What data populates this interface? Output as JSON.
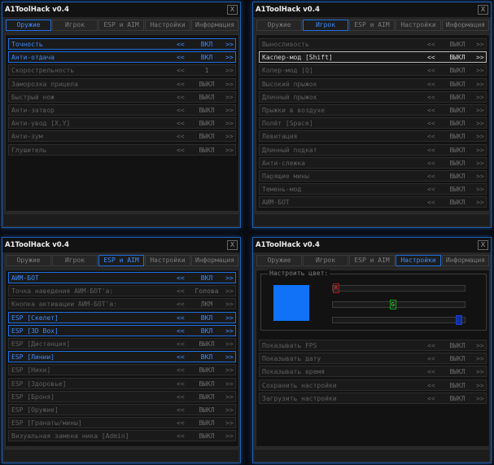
{
  "title": "A1ToolHack v0.4",
  "close": "X",
  "tabs": [
    "Оружие",
    "Игрок",
    "ESP и AIM",
    "Настройки",
    "Информация"
  ],
  "arrow_left": "<<",
  "arrow_right": ">>",
  "colors": {
    "accent": "#1f6fe0",
    "preview": "#0f72f7"
  },
  "weapons": {
    "rows": [
      {
        "label": "Точность",
        "value": "ВКЛ",
        "state": "on"
      },
      {
        "label": "Анти-отдача",
        "value": "ВКЛ",
        "state": "on"
      },
      {
        "label": "Скорострельность",
        "value": "1",
        "state": "off"
      },
      {
        "label": "Заморозка прицела",
        "value": "ВЫКЛ",
        "state": "off"
      },
      {
        "label": "Быстрый нож",
        "value": "ВЫКЛ",
        "state": "off"
      },
      {
        "label": "Анти-затвор",
        "value": "ВЫКЛ",
        "state": "off"
      },
      {
        "label": "Анти-увод [X,Y]",
        "value": "ВЫКЛ",
        "state": "off"
      },
      {
        "label": "Анти-зум",
        "value": "ВЫКЛ",
        "state": "off"
      },
      {
        "label": "Глушитель",
        "value": "ВЫКЛ",
        "state": "off"
      }
    ]
  },
  "player": {
    "rows": [
      {
        "label": "Выносливость",
        "value": "ВЫКЛ",
        "state": "off"
      },
      {
        "label": "Каспер-мод [Shift]",
        "value": "ВЫКЛ",
        "state": "sel"
      },
      {
        "label": "Копер-мод [Q]",
        "value": "ВЫКЛ",
        "state": "off"
      },
      {
        "label": "Высокий прыжок",
        "value": "ВЫКЛ",
        "state": "off"
      },
      {
        "label": "Длинный прыжок",
        "value": "ВЫКЛ",
        "state": "off"
      },
      {
        "label": "Прыжки в воздухе",
        "value": "ВЫКЛ",
        "state": "off"
      },
      {
        "label": "Полёт [Space]",
        "value": "ВЫКЛ",
        "state": "off"
      },
      {
        "label": "Левитация",
        "value": "ВЫКЛ",
        "state": "off"
      },
      {
        "label": "Длинный подкат",
        "value": "ВЫКЛ",
        "state": "off"
      },
      {
        "label": "Анти-слежка",
        "value": "ВЫКЛ",
        "state": "off"
      },
      {
        "label": "Парящие мины",
        "value": "ВЫКЛ",
        "state": "off"
      },
      {
        "label": "Темень-мод",
        "value": "ВЫКЛ",
        "state": "off"
      },
      {
        "label": "АИМ-БОТ",
        "value": "ВЫКЛ",
        "state": "off"
      }
    ]
  },
  "esp": {
    "rows": [
      {
        "label": "АИМ-БОТ",
        "value": "ВКЛ",
        "state": "on"
      },
      {
        "label": "Точка наведения АИМ-БОТ'а:",
        "value": "Голова",
        "state": "off"
      },
      {
        "label": "Кнопка активации АИМ-БОТ'а:",
        "value": "ЛКМ",
        "state": "off"
      },
      {
        "label": "ESP [Скелет]",
        "value": "ВКЛ",
        "state": "on"
      },
      {
        "label": "ESP [3D Box]",
        "value": "ВКЛ",
        "state": "on"
      },
      {
        "label": "ESP [Дистанция]",
        "value": "ВЫКЛ",
        "state": "off"
      },
      {
        "label": "ESP [Линии]",
        "value": "ВКЛ",
        "state": "on"
      },
      {
        "label": "ESP [Ники]",
        "value": "ВЫКЛ",
        "state": "off"
      },
      {
        "label": "ESP [Здоровье]",
        "value": "ВЫКЛ",
        "state": "off"
      },
      {
        "label": "ESP [Броня]",
        "value": "ВЫКЛ",
        "state": "off"
      },
      {
        "label": "ESP [Оружие]",
        "value": "ВЫКЛ",
        "state": "off"
      },
      {
        "label": "ESP [Гранаты/мины]",
        "value": "ВЫКЛ",
        "state": "off"
      },
      {
        "label": "Визуальная замена ника [Admin]",
        "value": "ВЫКЛ",
        "state": "off"
      }
    ]
  },
  "settings": {
    "color_title": "Настроить цвет:",
    "sliders": [
      {
        "channel": "R",
        "value": 0
      },
      {
        "channel": "G",
        "value": 114
      },
      {
        "channel": "B",
        "value": 247
      }
    ],
    "rows": [
      {
        "label": "Показывать FPS",
        "value": "ВЫКЛ",
        "state": "off"
      },
      {
        "label": "Показывать дату",
        "value": "ВЫКЛ",
        "state": "off"
      },
      {
        "label": "Показывать время",
        "value": "ВЫКЛ",
        "state": "off"
      },
      {
        "label": "Сохранить настройки",
        "value": "ВЫКЛ",
        "state": "off"
      },
      {
        "label": "Загрузить настройки",
        "value": "ВЫКЛ",
        "state": "off"
      }
    ]
  }
}
